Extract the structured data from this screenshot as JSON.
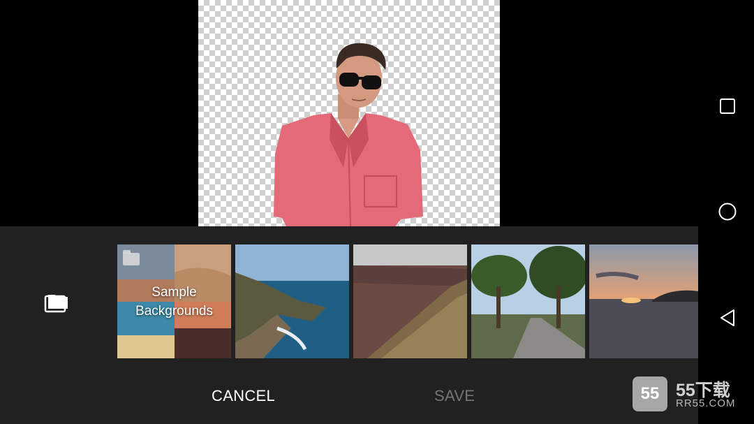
{
  "editor": {
    "preview_subject": "person-cutout"
  },
  "panel": {
    "folder_icon": "folder-stack-icon",
    "sample_backgrounds": {
      "line1": "Sample",
      "line2": "Backgrounds"
    },
    "thumbnails": [
      "sea-cliff",
      "canyon-ridge",
      "tree-lined-road",
      "sunset-sea"
    ],
    "cancel_label": "CANCEL",
    "save_label": "SAVE"
  },
  "navbar": {
    "recents_icon": "square-icon",
    "home_icon": "circle-icon",
    "back_icon": "triangle-back-icon"
  },
  "watermark": {
    "logo_text": "55",
    "title": "55下载",
    "url": "RR55.COM"
  },
  "colors": {
    "panel_bg": "#212121",
    "cancel_text": "#ffffff",
    "save_text_disabled": "#757575"
  }
}
